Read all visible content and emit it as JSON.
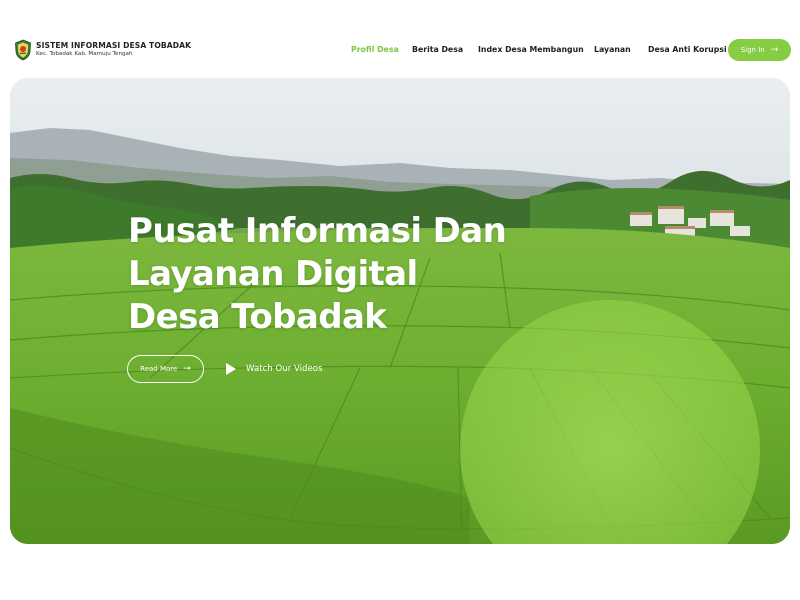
{
  "brand": {
    "title": "SISTEM INFORMASI DESA TOBADAK",
    "subtitle": "Kec. Tobadak Kab. Mamuju Tengah"
  },
  "nav": {
    "items": [
      {
        "label": "Profil Desa",
        "active": true
      },
      {
        "label": "Berita Desa",
        "active": false
      },
      {
        "label": "Index Desa Membangun",
        "active": false
      },
      {
        "label": "Layanan",
        "active": false
      },
      {
        "label": "Desa Anti Korupsi",
        "active": false
      }
    ],
    "signin_label": "Sign In"
  },
  "hero": {
    "headline_lines": [
      "Pusat Informasi Dan",
      "Layanan Digital",
      "Desa Tobadak"
    ],
    "read_more_label": "Read More",
    "watch_label": "Watch Our Videos"
  },
  "icons": {
    "logo": "village-emblem-icon",
    "arrow": "arrow-right-icon",
    "play": "play-icon"
  },
  "colors": {
    "accent": "#86cc45",
    "active_nav": "#7fc73e",
    "text_dark": "#1f1f1f"
  }
}
